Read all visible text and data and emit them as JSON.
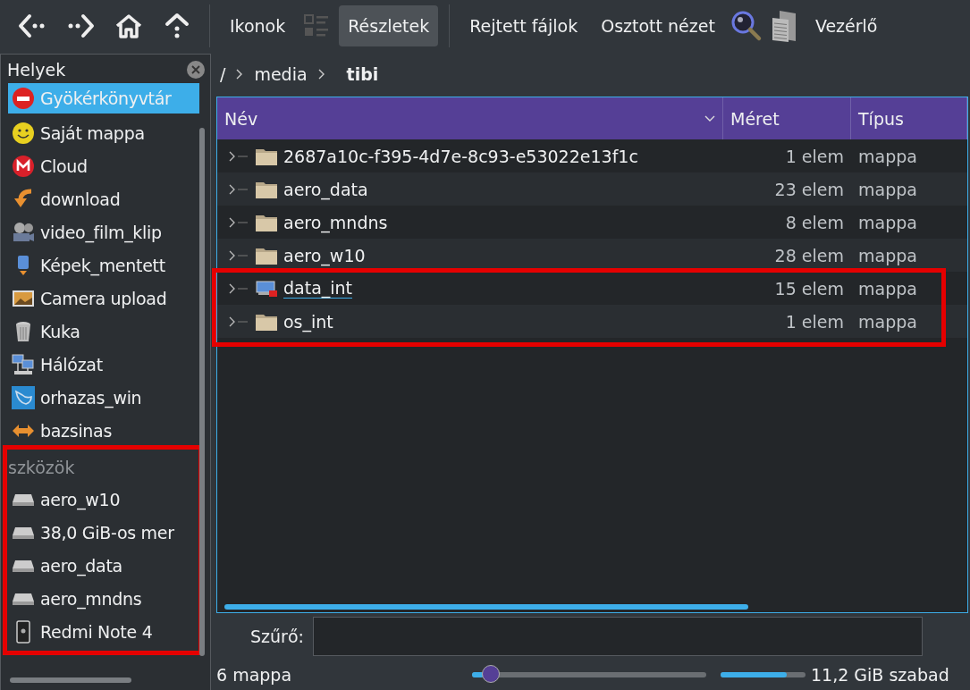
{
  "toolbar": {
    "view_buttons": [
      {
        "label": "Ikonok",
        "selected": false
      },
      {
        "label": "Részletek",
        "selected": true
      }
    ],
    "buttons": [
      "Rejtett fájlok",
      "Osztott nézet"
    ],
    "control_button": "Vezérlő"
  },
  "places": {
    "title": "Helyek",
    "items": [
      {
        "label": "Gyökérkönyvtár",
        "selected": true
      },
      {
        "label": "Saját mappa",
        "selected": false
      },
      {
        "label": "Cloud",
        "selected": false
      },
      {
        "label": "download",
        "selected": false
      },
      {
        "label": "video_film_klip",
        "selected": false
      },
      {
        "label": "Képek_mentett",
        "selected": false
      },
      {
        "label": "Camera upload",
        "selected": false
      },
      {
        "label": "Kuka",
        "selected": false
      },
      {
        "label": "Hálózat",
        "selected": false
      },
      {
        "label": "orhazas_win",
        "selected": false
      },
      {
        "label": "bazsinas",
        "selected": false
      }
    ],
    "devices_title": "szközök",
    "devices_highlighted": true,
    "devices": [
      {
        "label": "aero_w10",
        "kind": "drive"
      },
      {
        "label": "38,0 GiB-os mer",
        "kind": "drive"
      },
      {
        "label": "aero_data",
        "kind": "drive"
      },
      {
        "label": "aero_mndns",
        "kind": "drive"
      },
      {
        "label": "Redmi Note 4",
        "kind": "phone"
      }
    ]
  },
  "breadcrumb": [
    "/",
    "media",
    "tibi"
  ],
  "table": {
    "columns": [
      "Név",
      "Méret",
      "Típus"
    ],
    "rows": [
      {
        "name": "2687a10c-f395-4d7e-8c93-e53022e13f1c",
        "size": "1 elem",
        "type": "mappa",
        "kind": "folder",
        "highlighted": false,
        "renaming": false
      },
      {
        "name": "aero_data",
        "size": "23 elem",
        "type": "mappa",
        "kind": "folder",
        "highlighted": false,
        "renaming": false
      },
      {
        "name": "aero_mndns",
        "size": "8 elem",
        "type": "mappa",
        "kind": "folder",
        "highlighted": false,
        "renaming": false
      },
      {
        "name": "aero_w10",
        "size": "28 elem",
        "type": "mappa",
        "kind": "folder",
        "highlighted": false,
        "renaming": false
      },
      {
        "name": "data_int",
        "size": "15 elem",
        "type": "mappa",
        "kind": "network-folder",
        "highlighted": true,
        "renaming": true
      },
      {
        "name": "os_int",
        "size": "1 elem",
        "type": "mappa",
        "kind": "folder",
        "highlighted": true,
        "renaming": false
      }
    ]
  },
  "filter": {
    "label": "Szűrő:"
  },
  "status": {
    "count": "6 mappa",
    "zoom": {
      "level": 0.05
    },
    "free_space": {
      "level": 0.78
    },
    "free_text": "11,2 GiB szabad"
  }
}
